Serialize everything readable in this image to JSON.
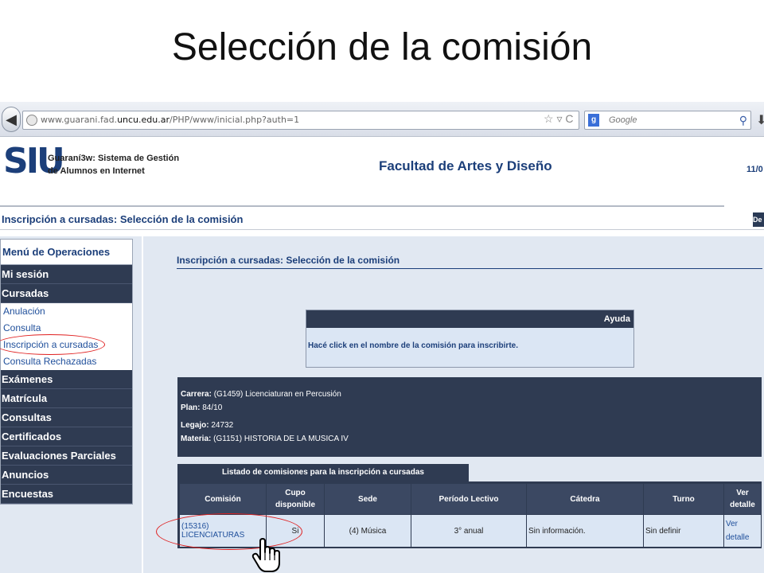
{
  "slide": {
    "title": "Selección de la comisión"
  },
  "browser": {
    "url_prefix": "www.guarani.fad.",
    "url_host": "uncu.edu.ar",
    "url_path": "/PHP/www/inicial.php?auth=1",
    "search_placeholder": "Google",
    "url_icons": "☆ ▿ C"
  },
  "header": {
    "logo": "SIU",
    "system_line1": "Guaraní3w: Sistema de Gestión",
    "system_line2": "de Alumnos en Internet",
    "faculty": "Facultad de Artes y Diseño",
    "date_partial": "11/0",
    "logout_label": "De"
  },
  "page_heading": "Inscripción a cursadas: Selección de la comisión",
  "menu": {
    "title": "Menú de Operaciones",
    "mi_sesion": "Mi sesión",
    "cursadas": "Cursadas",
    "cursadas_items": [
      "Anulación",
      "Consulta",
      "Inscripción a cursadas",
      "Consulta Rechazadas"
    ],
    "sections": [
      "Exámenes",
      "Matrícula",
      "Consultas",
      "Certificados",
      "Evaluaciones Parciales",
      "Anuncios",
      "Encuestas"
    ]
  },
  "content": {
    "title": "Inscripción a cursadas: Selección de la comisión",
    "help_title": "Ayuda",
    "help_text": "Hacé click en el nombre de la comisión para inscribirte.",
    "info": {
      "carrera_label": "Carrera:",
      "carrera_value": " (G1459) Licenciaturan en Percusión",
      "plan_label": "Plan:",
      "plan_value": " 84/10",
      "legajo_label": "Legajo:",
      "legajo_value": " 24732",
      "materia_label": "Materia:",
      "materia_value": " (G1151) HISTORIA DE LA MUSICA IV"
    },
    "list_title": "Listado de comisiones para la inscripción a cursadas",
    "table": {
      "headers": [
        "Comisión",
        "Cupo disponible",
        "Sede",
        "Período Lectivo",
        "Cátedra",
        "Turno",
        "Ver detalle"
      ],
      "rows": [
        [
          "(15316) LICENCIATURAS",
          "Si",
          "(4) Música",
          "3° anual",
          "Sin información.",
          "Sin definir",
          "Ver detalle"
        ]
      ]
    }
  },
  "icons": [
    "back-icon",
    "globe-icon",
    "google-icon",
    "search-icon",
    "download-icon",
    "hand-cursor-icon"
  ],
  "colors": {
    "navy": "#2f3b52",
    "link": "#1f4f9b",
    "panel": "#e1e8f2",
    "highlight": "#e02020"
  }
}
